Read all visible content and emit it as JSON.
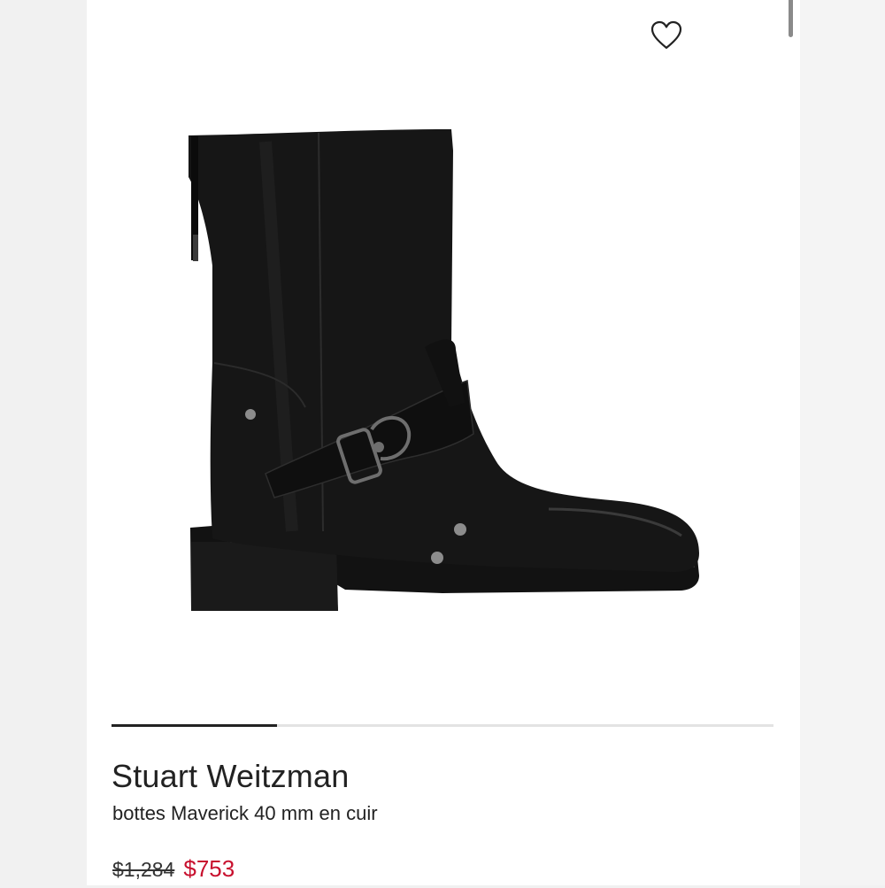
{
  "product": {
    "brand": "Stuart Weitzman",
    "name": "bottes Maverick 40 mm en cuir",
    "original_price": "$1,284",
    "sale_price": "$753"
  },
  "gallery": {
    "progress_fraction": 0.25
  },
  "icons": {
    "wishlist": "heart-outline-icon",
    "product_image": "black-leather-buckle-boot"
  },
  "colors": {
    "sale_price": "#c8102e",
    "text": "#222222",
    "progress": "#222222"
  }
}
